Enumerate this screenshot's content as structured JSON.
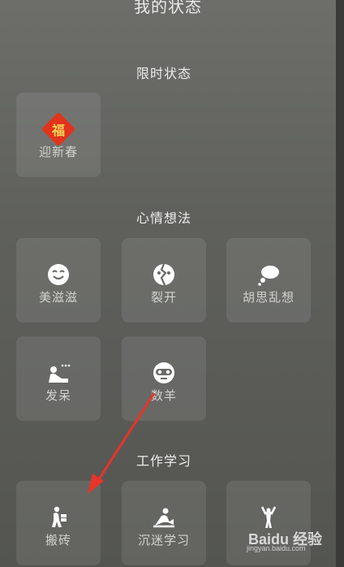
{
  "title": "我的状态",
  "sections": [
    {
      "heading": "限时状态",
      "items": [
        {
          "label": "迎新春",
          "icon": "fu-icon",
          "glyph": "福"
        }
      ]
    },
    {
      "heading": "心情想法",
      "items": [
        {
          "label": "美滋滋",
          "icon": "smile-icon"
        },
        {
          "label": "裂开",
          "icon": "cracked-face-icon"
        },
        {
          "label": "胡思乱想",
          "icon": "thought-bubble-icon"
        },
        {
          "label": "发呆",
          "icon": "daydream-icon"
        },
        {
          "label": "数羊",
          "icon": "sleep-mask-icon"
        }
      ]
    },
    {
      "heading": "工作学习",
      "items": [
        {
          "label": "搬砖",
          "icon": "carry-bricks-icon"
        },
        {
          "label": "沉迷学习",
          "icon": "studying-icon"
        },
        {
          "label": "",
          "icon": "stretching-person-icon"
        }
      ]
    }
  ],
  "annotation_color": "#e8342a",
  "watermark": {
    "line1": "Baidu 经验",
    "line2": "jingyan.baidu.com"
  }
}
